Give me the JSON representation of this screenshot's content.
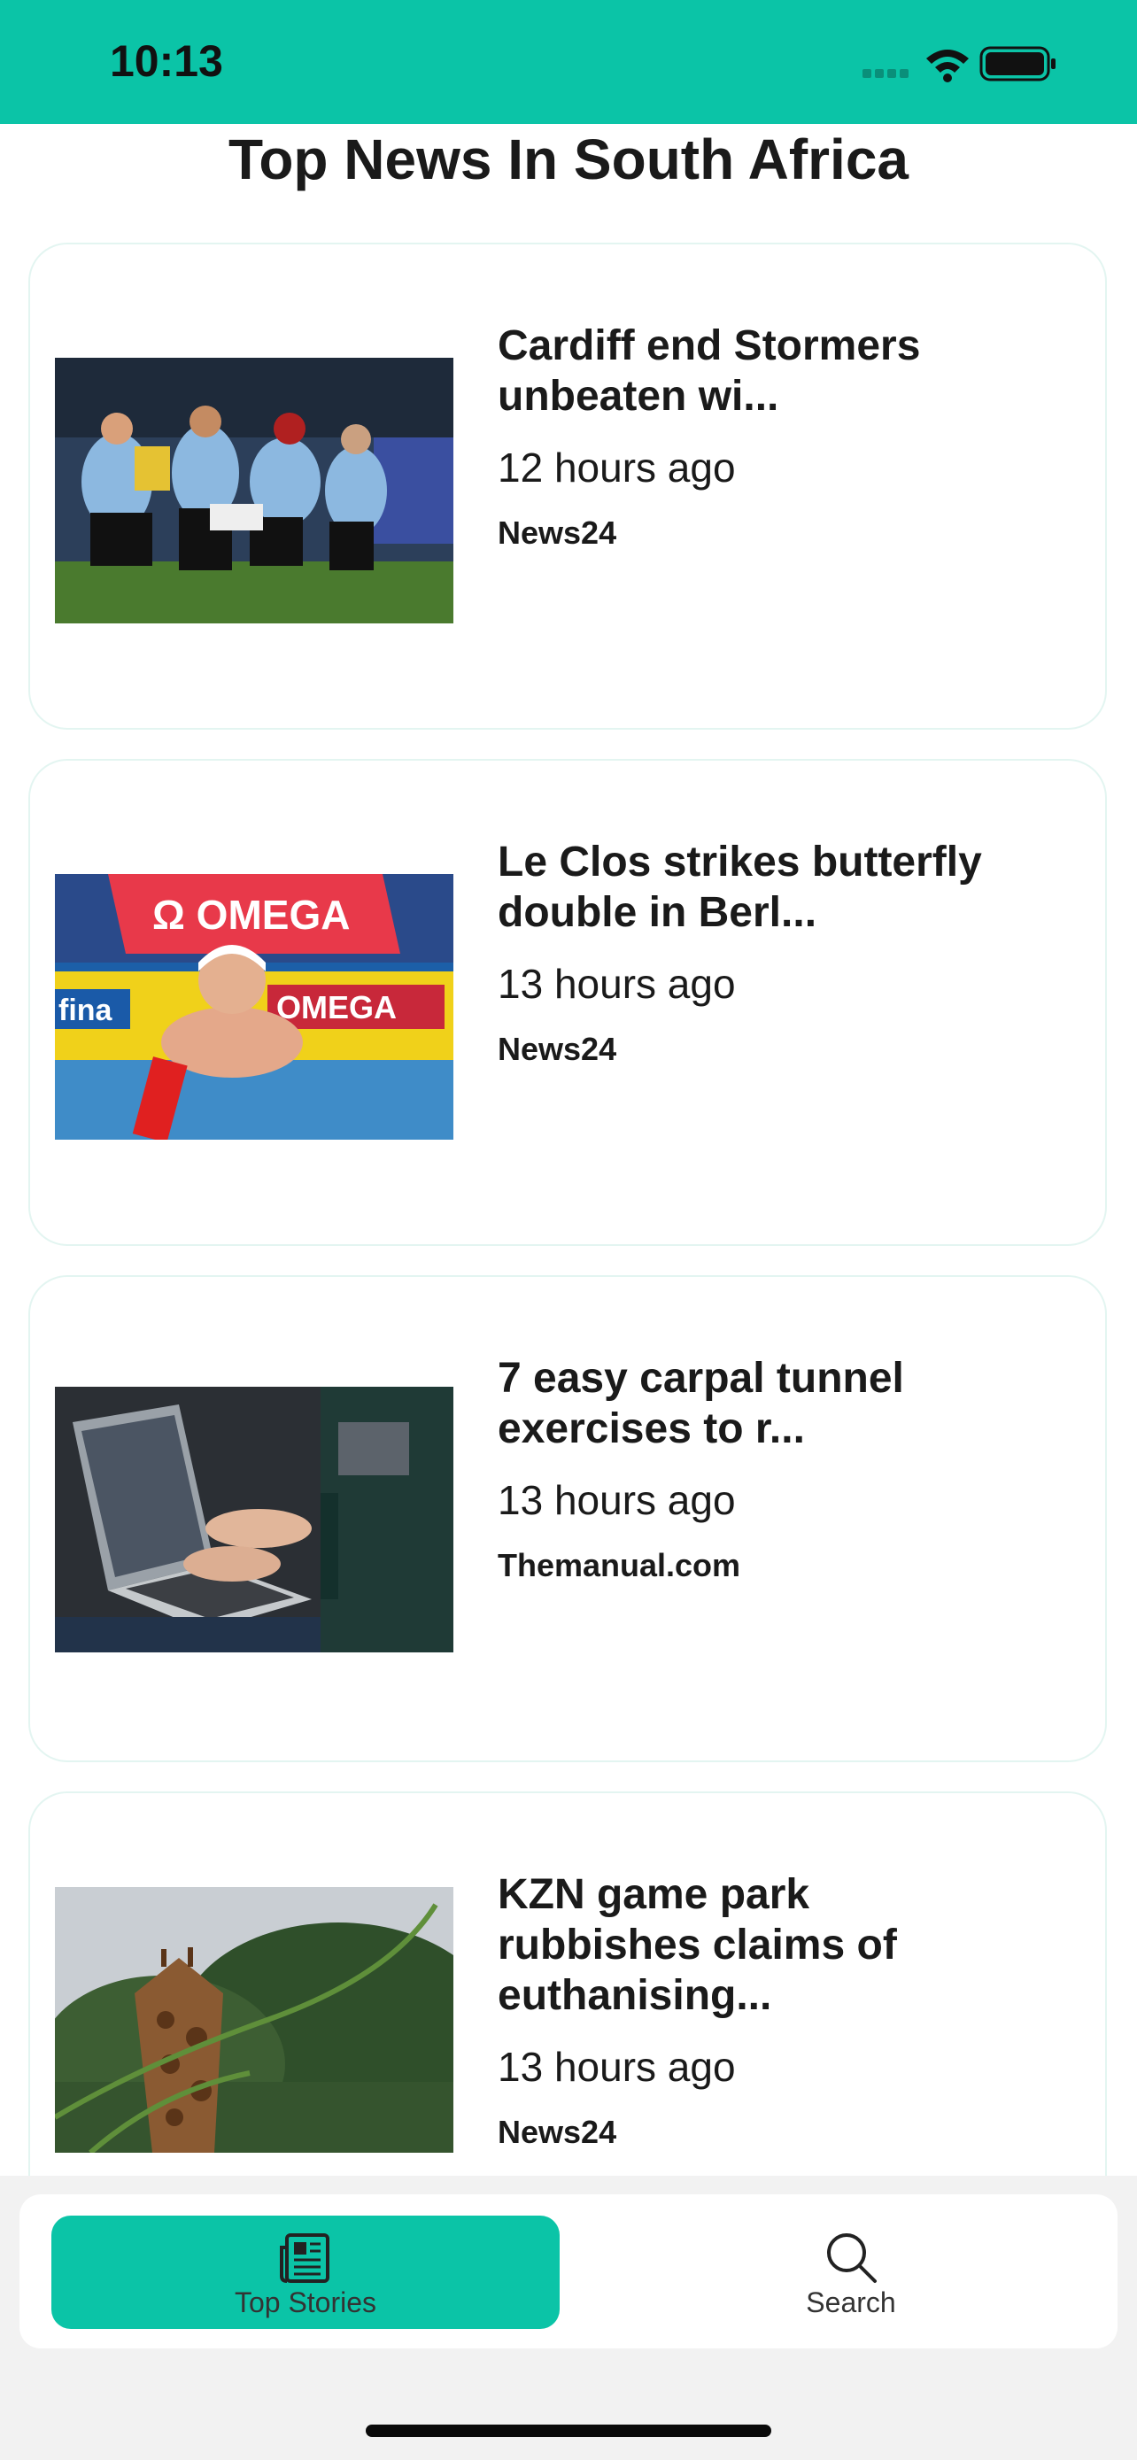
{
  "status": {
    "time": "10:13"
  },
  "header": {
    "title": "Top News In South Africa"
  },
  "articles": [
    {
      "title": "Cardiff end Stormers unbeaten wi...",
      "time": "12 hours ago",
      "source": "News24",
      "image_icon": "rugby-photo"
    },
    {
      "title": "Le Clos strikes butterfly double in Berl...",
      "time": "13 hours ago",
      "source": "News24",
      "image_icon": "swimmer-photo"
    },
    {
      "title": "7 easy carpal tunnel exercises to r...",
      "time": "13 hours ago",
      "source": "Themanual.com",
      "image_icon": "laptop-photo"
    },
    {
      "title": "KZN game park rubbishes claims of euthanising...",
      "time": "13 hours ago",
      "source": "News24",
      "image_icon": "giraffe-photo"
    }
  ],
  "tabbar": {
    "tabs": [
      {
        "label": "Top Stories",
        "icon": "newspaper-icon",
        "active": true
      },
      {
        "label": "Search",
        "icon": "search-icon",
        "active": false
      }
    ]
  },
  "colors": {
    "accent": "#0bc4a7",
    "card_border": "#e3f5f1",
    "tabbar_bg": "#f2f2f2"
  }
}
